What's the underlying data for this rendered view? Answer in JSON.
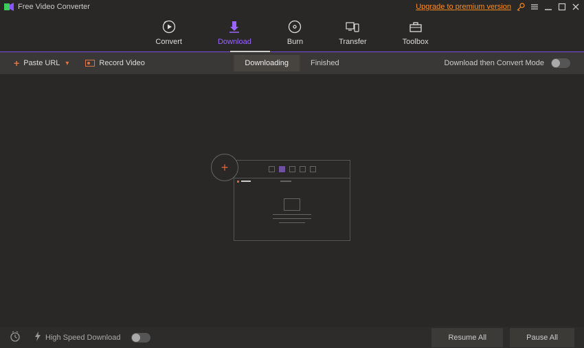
{
  "titlebar": {
    "app_title": "Free Video Converter",
    "upgrade_text": "Upgrade to premium version"
  },
  "nav": {
    "convert": "Convert",
    "download": "Download",
    "burn": "Burn",
    "transfer": "Transfer",
    "toolbox": "Toolbox"
  },
  "toolbar": {
    "paste_url": "Paste URL",
    "record_video": "Record Video",
    "downloading": "Downloading",
    "finished": "Finished",
    "mode_label": "Download then Convert Mode"
  },
  "bottom": {
    "hsd_label": "High Speed Download",
    "resume": "Resume All",
    "pause": "Pause All"
  },
  "colors": {
    "accent_purple": "#9966ff",
    "accent_orange": "#e07444"
  }
}
